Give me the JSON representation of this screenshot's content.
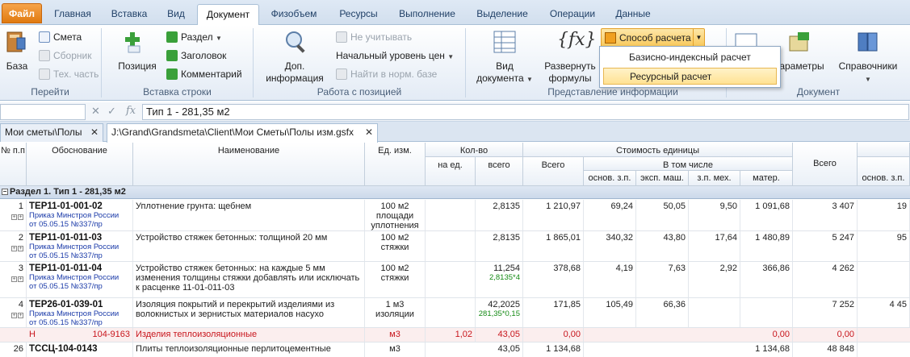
{
  "tabs": [
    "Файл",
    "Главная",
    "Вставка",
    "Вид",
    "Документ",
    "Физобъем",
    "Ресурсы",
    "Выполнение",
    "Выделение",
    "Операции",
    "Данные"
  ],
  "ribbon": {
    "group_labels": [
      "Перейти",
      "Вставка строки",
      "Работа с позицией",
      "Представление информации",
      "Документ"
    ],
    "baza": "База",
    "smeta": "Смета",
    "sbornik": "Сборник",
    "tex_chast": "Тех. часть",
    "pozitsiya": "Позиция",
    "razdel": "Раздел",
    "zagolovok": "Заголовок",
    "kommentariy": "Комментарий",
    "dop_info_1": "Доп.",
    "dop_info_2": "информация",
    "ne_uchityvat": "Не учитывать",
    "nach_uroven": "Начальный уровень цен",
    "nayti": "Найти в норм. базе",
    "vid_dok_1": "Вид",
    "vid_dok_2": "документа",
    "razvernut_1": "Развернуть",
    "razvernut_2": "формулы",
    "sposob": "Способ расчета",
    "parametry": "араметры",
    "spravochniki": "Справочники"
  },
  "menu": {
    "item1": "Базисно-индексный расчет",
    "item2": "Ресурсный расчет"
  },
  "formula": {
    "fx": "fx",
    "value": "Тип 1 - 281,35 м2"
  },
  "doctabs": {
    "tab1": "Мои сметы\\Полы",
    "tab2": "J:\\Grand\\Grandsmeta\\Client\\Мои Сметы\\Полы изм.gsfx"
  },
  "grid": {
    "h_no": "№ п.п",
    "h_obosn": "Обоснование",
    "h_naim": "Наименование",
    "h_ed": "Ед. изм.",
    "h_kolvo": "Кол-во",
    "h_na_ed": "на ед.",
    "h_vsego": "всего",
    "h_stoim": "Стоимость единицы",
    "h_st_vsego": "Всего",
    "h_v_tom": "В том числе",
    "h_osn": "основ. з.п.",
    "h_eksp": "эксп. маш.",
    "h_zp_meh": "з.п. мех.",
    "h_mater": "матер.",
    "h_total": "Всего",
    "h_osn2": "основ. з.п.",
    "section": "Раздел 1. Тип 1 - 281,35 м2",
    "rows": [
      {
        "n": "1",
        "code": "ТЕР11-01-001-02",
        "order1": "Приказ Минстроя России",
        "order2": "от 05.05.15 №337/пр",
        "name": "Уплотнение грунта: щебнем",
        "unit": "100 м2 площади уплотнения",
        "na_ed": "",
        "qty": "2,8135",
        "qty2": "",
        "vsego": "1 210,97",
        "osn": "69,24",
        "eksp": "50,05",
        "zpm": "9,50",
        "mat": "1 091,68",
        "total": "3 407",
        "osn2": "19"
      },
      {
        "n": "2",
        "code": "ТЕР11-01-011-03",
        "order1": "Приказ Минстроя России",
        "order2": "от 05.05.15 №337/пр",
        "name": "Устройство стяжек бетонных: толщиной 20 мм",
        "unit": "100 м2 стяжки",
        "na_ed": "",
        "qty": "2,8135",
        "qty2": "",
        "vsego": "1 865,01",
        "osn": "340,32",
        "eksp": "43,80",
        "zpm": "17,64",
        "mat": "1 480,89",
        "total": "5 247",
        "osn2": "95"
      },
      {
        "n": "3",
        "code": "ТЕР11-01-011-04",
        "order1": "Приказ Минстроя России",
        "order2": "от 05.05.15 №337/пр",
        "name": "Устройство стяжек бетонных: на каждые 5 мм изменения толщины стяжки добавлять или исключать к расценке 11-01-011-03",
        "unit": "100 м2 стяжки",
        "na_ed": "",
        "qty": "11,254",
        "qty2": "2,8135*4",
        "vsego": "378,68",
        "osn": "4,19",
        "eksp": "7,63",
        "zpm": "2,92",
        "mat": "366,86",
        "total": "4 262",
        "osn2": ""
      },
      {
        "n": "4",
        "code": "ТЕР26-01-039-01",
        "order1": "Приказ Минстроя России",
        "order2": "от 05.05.15 №337/пр",
        "name": "Изоляция покрытий и перекрытий изделиями из волокнистых и зернистых материалов насухо",
        "unit": "1 м3 изоляции",
        "na_ed": "",
        "qty": "42,2025",
        "qty2": "281,35*0,15",
        "vsego": "171,85",
        "osn": "105,49",
        "eksp": "66,36",
        "zpm": "",
        "mat": "",
        "total": "7 252",
        "osn2": "4 45"
      }
    ],
    "res_row": {
      "mark": "Н",
      "code": "104-9163",
      "name": "Изделия теплоизоляционные",
      "unit": "м3",
      "na_ed": "1,02",
      "qty": "43,05",
      "vsego": "0,00",
      "mat": "0,00",
      "total": "0,00"
    },
    "last_row": {
      "n": "26",
      "code": "ТССЦ-104-0143",
      "name": "Плиты теплоизоляционные перлитоцементные",
      "unit": "м3",
      "qty": "43,05",
      "vsego": "1 134,68",
      "mat": "1 134,68",
      "total": "48 848"
    }
  },
  "colors": {
    "accent": "#f8c85a",
    "file_tab": "#e07a10",
    "resource_red": "#c8161d",
    "order_blue": "#1a3aa8",
    "formula_green": "#148a14"
  }
}
